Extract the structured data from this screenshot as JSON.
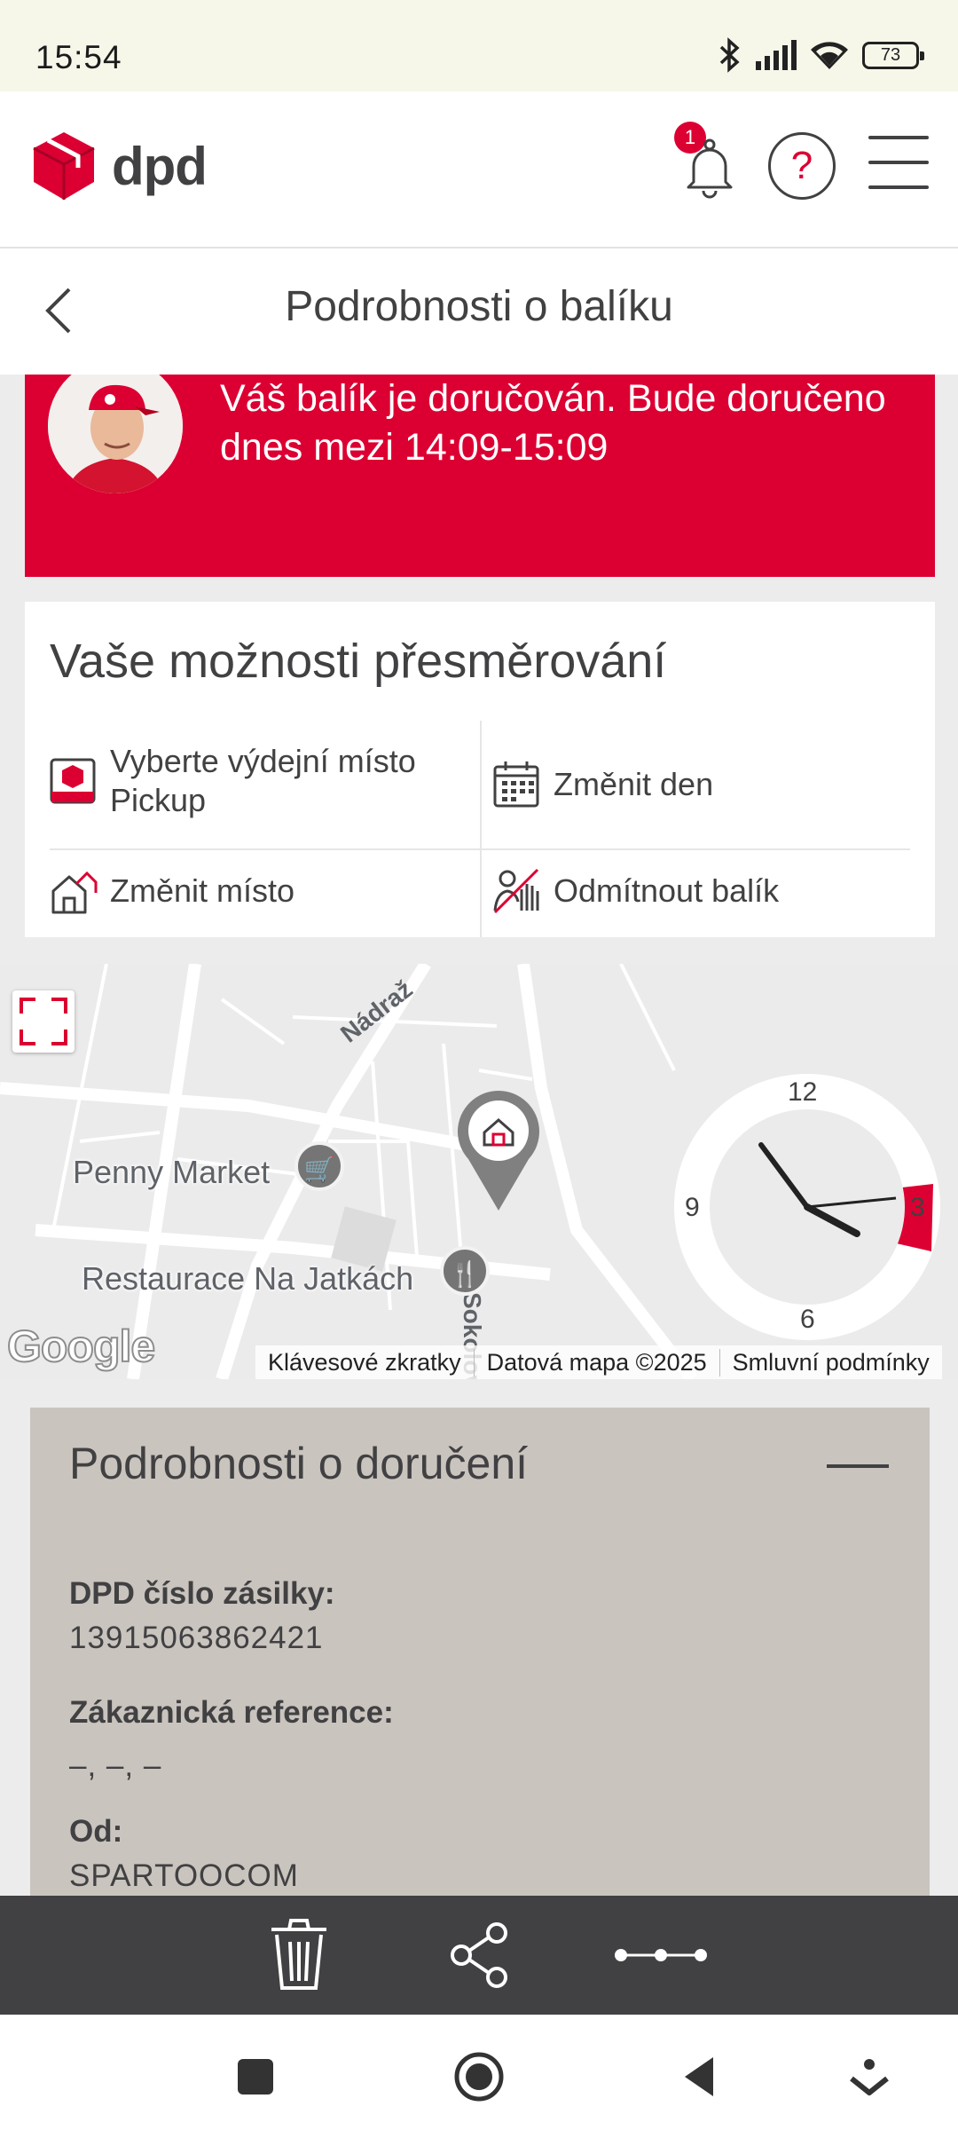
{
  "status_bar": {
    "time": "15:54",
    "battery": "73"
  },
  "header": {
    "logo_text": "dpd",
    "notification_count": "1"
  },
  "title_bar": {
    "title": "Podrobnosti o balíku"
  },
  "banner": {
    "message": "Váš balík je doručován. Bude doručeno dnes mezi 14:09-15:09"
  },
  "redirect": {
    "title": "Vaše možnosti přesměrování",
    "options": [
      {
        "label": "Vyberte výdejní místo Pickup",
        "icon": "pickup-icon"
      },
      {
        "label": "Změnit den",
        "icon": "calendar-icon"
      },
      {
        "label": "Změnit místo",
        "icon": "house-icon"
      },
      {
        "label": "Odmítnout balík",
        "icon": "refuse-hand-icon"
      }
    ]
  },
  "map": {
    "pois": [
      {
        "name": "Penny Market",
        "icon": "cart-icon"
      },
      {
        "name": "Restaurace Na Jatkách",
        "icon": "restaurant-icon"
      }
    ],
    "streets": [
      "Nádraž",
      "Sokolovská"
    ],
    "clock": {
      "n12": "12",
      "n3": "3",
      "n6": "6",
      "n9": "9"
    },
    "google": "Google",
    "attribution": [
      "Klávesové zkratky",
      "Datová mapa ©2025",
      "Smluvní podmínky"
    ]
  },
  "details": {
    "title": "Podrobnosti o doručení",
    "fields": [
      {
        "label": "DPD číslo zásilky:",
        "value": "13915063862421"
      },
      {
        "label": "Zákaznická reference:",
        "value": "–, –, –"
      },
      {
        "label": "Od:",
        "value": "SPARTOOCOM"
      }
    ]
  },
  "colors": {
    "brand_red": "#dc0032",
    "text_dark": "#414042",
    "details_bg": "#c9c4be",
    "toolbar_bg": "#414042"
  }
}
